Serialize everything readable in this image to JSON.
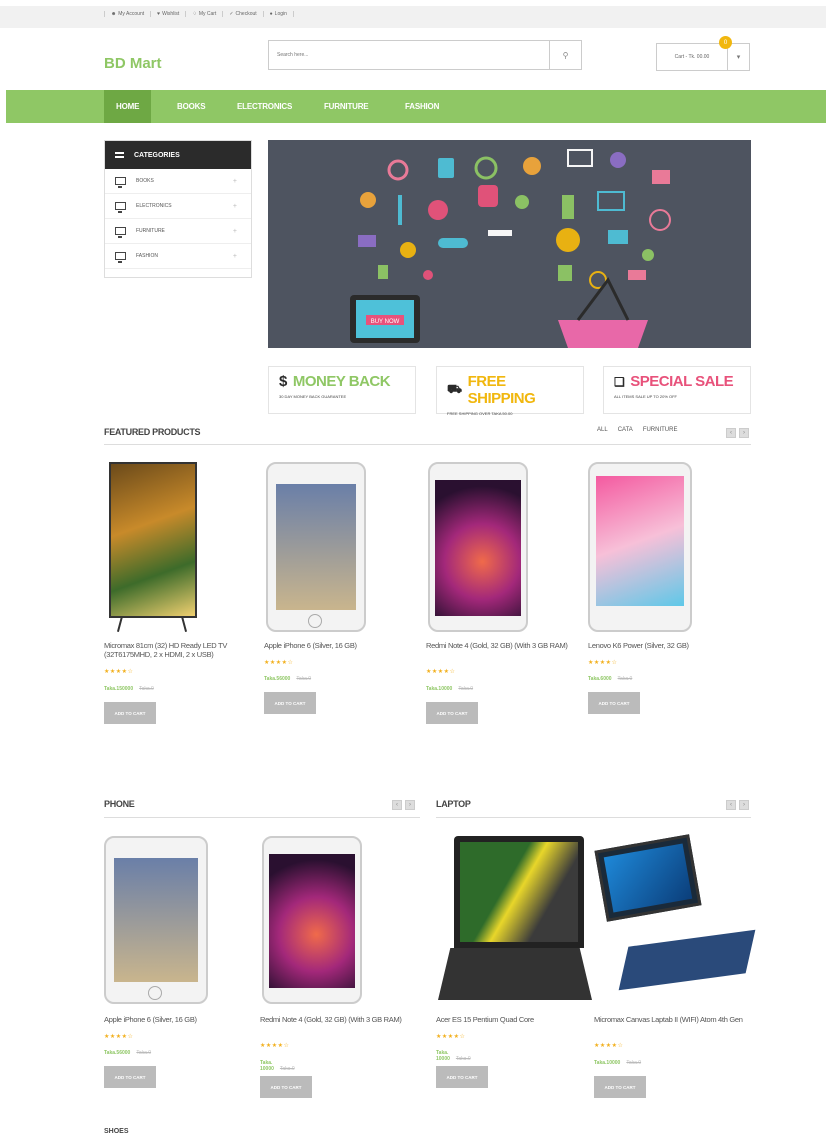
{
  "topbar": {
    "links": [
      "My Account",
      "Wishlist",
      "My Cart",
      "Checkout",
      "Login"
    ]
  },
  "header": {
    "logo": "BD Mart",
    "search_placeholder": "Search here...",
    "cart_text": "Cart - Tk. 00.00",
    "cart_count": "0"
  },
  "nav": {
    "items": [
      "HOME",
      "BOOKS",
      "ELECTRONICS",
      "FURNITURE",
      "FASHION"
    ],
    "active": "HOME"
  },
  "categories": {
    "title": "CATEGORIES",
    "items": [
      "BOOKS",
      "ELECTRONICS",
      "FURNITURE",
      "FASHION"
    ]
  },
  "banner": {
    "cta": "BUY NOW"
  },
  "features": [
    {
      "icon": "$",
      "title": "MONEY BACK",
      "sub": "30 DAY MONEY BACK GUARANTEE",
      "color": "#8fc765"
    },
    {
      "icon": "truck",
      "title": "FREE SHIPPING",
      "sub": "FREE SHIPPING OVER TAKA 50.00",
      "color": "#f1b70e"
    },
    {
      "icon": "gift",
      "title": "SPECIAL SALE",
      "sub": "ALL ITEMS SALE UP TO 20% OFF",
      "color": "#e8527b"
    }
  ],
  "featured": {
    "title": "FEATURED PRODUCTS",
    "filters": [
      "ALL",
      "CATA",
      "FURNITURE"
    ],
    "products": [
      {
        "name": "Micromax 81cm (32) HD Ready LED TV (32T6175MHD, 2 x HDMI, 2 x USB)",
        "stars": "★★★★☆",
        "price": "Taka.150000",
        "old": "Taka.0",
        "btn": "ADD TO CART"
      },
      {
        "name": "Apple iPhone 6 (Silver, 16 GB)",
        "stars": "★★★★☆",
        "price": "Taka.56000",
        "old": "Taka.0",
        "btn": "ADD TO CART"
      },
      {
        "name": "Redmi Note 4 (Gold, 32 GB) (With 3 GB RAM)",
        "stars": "★★★★☆",
        "price": "Taka.10000",
        "old": "Taka.0",
        "btn": "ADD TO CART"
      },
      {
        "name": "Lenovo K6 Power (Silver, 32 GB)",
        "stars": "★★★★☆",
        "price": "Taka.6000",
        "old": "Taka.0",
        "btn": "ADD TO CART"
      }
    ]
  },
  "phone": {
    "title": "PHONE",
    "products": [
      {
        "name": "Apple iPhone 6 (Silver, 16 GB)",
        "stars": "★★★★☆",
        "price": "Taka.56000",
        "old": "Taka.0",
        "btn": "ADD TO CART"
      },
      {
        "name": "Redmi Note 4 (Gold, 32 GB) (With 3 GB RAM)",
        "stars": "★★★★☆",
        "price": "Taka. 10000",
        "old": "Taka.0",
        "btn": "ADD TO CART"
      }
    ]
  },
  "laptop": {
    "title": "LAPTOP",
    "products": [
      {
        "name": "Acer ES 15 Pentium Quad Core",
        "stars": "★★★★☆",
        "price": "Taka. 10000",
        "old": "Taka.0",
        "btn": "ADD TO CART"
      },
      {
        "name": "Micromax Canvas Laptab II (WIFI) Atom 4th Gen",
        "stars": "★★★★☆",
        "price": "Taka.10000",
        "old": "Taka.0",
        "btn": "ADD TO CART"
      }
    ]
  },
  "footer_section": "SHOES",
  "colors": {
    "accent": "#8fc765",
    "nav_active": "#6ea844",
    "star": "#f2b01e"
  }
}
